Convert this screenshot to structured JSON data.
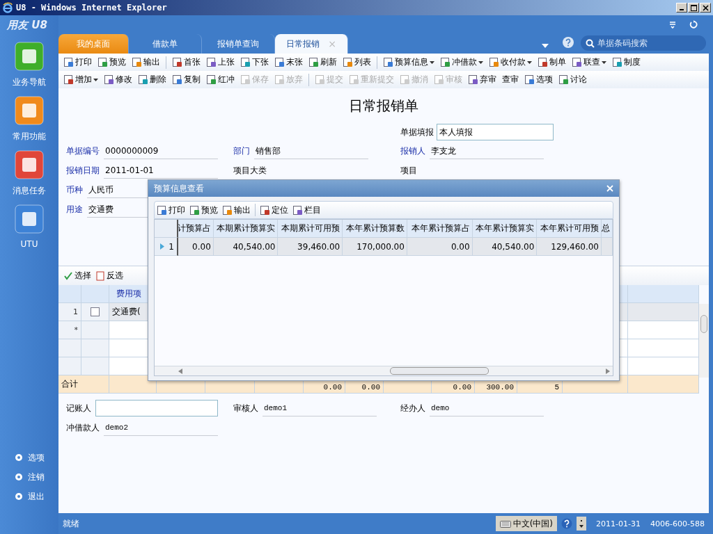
{
  "window": {
    "title": "U8 - Windows Internet Explorer"
  },
  "sidebar": {
    "logo": "用友 U8",
    "items": [
      {
        "label": "业务导航"
      },
      {
        "label": "常用功能"
      },
      {
        "label": "消息任务"
      },
      {
        "label": "UTU"
      }
    ],
    "bottom_items": [
      {
        "label": "选项"
      },
      {
        "label": "注销"
      },
      {
        "label": "退出"
      }
    ]
  },
  "tabs": [
    {
      "label": "我的桌面",
      "kind": "home",
      "selected": false
    },
    {
      "label": "借款单",
      "kind": "doc",
      "selected": false
    },
    {
      "label": "报销单查询",
      "kind": "doc",
      "selected": false
    },
    {
      "label": "日常报销",
      "kind": "doc",
      "selected": true,
      "close": "×"
    }
  ],
  "search": {
    "placeholder": "单据条码搜索"
  },
  "toolbar_rows": [
    [
      [
        {
          "label": "打印"
        },
        {
          "label": "预览"
        },
        {
          "label": "输出"
        }
      ],
      [
        {
          "label": "首张"
        },
        {
          "label": "上张"
        },
        {
          "label": "下张"
        },
        {
          "label": "末张"
        },
        {
          "label": "刷新"
        },
        {
          "label": "列表"
        }
      ],
      [
        {
          "label": "预算信息",
          "dropdown": true
        },
        {
          "label": "冲借款",
          "dropdown": true
        },
        {
          "label": "收付款",
          "dropdown": true
        },
        {
          "label": "制单"
        },
        {
          "label": "联查",
          "dropdown": true
        },
        {
          "label": "制度"
        }
      ]
    ],
    [
      [
        {
          "label": "增加",
          "dropdown": true
        },
        {
          "label": "修改"
        },
        {
          "label": "删除"
        },
        {
          "label": "复制"
        },
        {
          "label": "红冲"
        },
        {
          "label": "保存",
          "disabled": true
        },
        {
          "label": "放弃",
          "disabled": true
        }
      ],
      [
        {
          "label": "提交",
          "disabled": true
        },
        {
          "label": "重新提交",
          "disabled": true
        },
        {
          "label": "撤消",
          "disabled": true
        },
        {
          "label": "审核",
          "disabled": true
        },
        {
          "label": "弃审"
        },
        {
          "label": "查审",
          "no_icon": true
        },
        {
          "label": "选项"
        },
        {
          "label": "讨论"
        }
      ]
    ]
  ],
  "form": {
    "title": "日常报销单",
    "entry": {
      "label": "单据填报",
      "value": "本人填报"
    },
    "rows": [
      [
        {
          "label": "单据编号",
          "value": "0000000009",
          "required": true
        },
        {
          "label": "部门",
          "value": "销售部",
          "required": true
        },
        {
          "label": "报销人",
          "value": "李支龙",
          "required": true
        }
      ],
      [
        {
          "label": "报销日期",
          "value": "2011-01-01",
          "required": true
        },
        {
          "label": "项目大类",
          "required": false
        },
        {
          "label": "项目",
          "required": false
        }
      ],
      [
        {
          "label": "币种",
          "value": "人民币",
          "required": true
        }
      ],
      [
        {
          "label": "用途",
          "value": "交通费",
          "required": true
        }
      ]
    ]
  },
  "grid": {
    "toolbar": [
      {
        "label": "选择"
      },
      {
        "label": "反选"
      }
    ],
    "columns": [
      "费用项"
    ],
    "rows": [
      {
        "num": "1",
        "checked": false,
        "cells": [
          "交通费("
        ]
      },
      {
        "num": "*"
      }
    ],
    "totals": {
      "label": "合计",
      "values": [
        "0.00",
        "0.00",
        "0.00",
        "300.00",
        "5"
      ]
    }
  },
  "footer_fields": [
    [
      {
        "label": "记账人",
        "kind": "input"
      },
      {
        "label": "审核人",
        "value": "demo1",
        "kind": "text"
      },
      {
        "label": "经办人",
        "value": "demo",
        "kind": "text"
      }
    ],
    [
      {
        "label": "冲借款人",
        "value": "demo2",
        "kind": "text"
      }
    ]
  ],
  "dialog": {
    "title": "预算信息查看",
    "toolbar": [
      [
        {
          "label": "打印"
        },
        {
          "label": "预览"
        },
        {
          "label": "输出"
        }
      ],
      [
        {
          "label": "定位"
        },
        {
          "label": "栏目"
        }
      ]
    ],
    "columns": [
      "计预算占",
      "本期累计预算实",
      "本期累计可用预",
      "本年累计预算数",
      "本年累计预算占",
      "本年累计预算实",
      "本年累计可用预",
      "总"
    ],
    "rows": [
      {
        "num": "1",
        "selected": true,
        "cells": [
          "0.00",
          "40,540.00",
          "39,460.00",
          "170,000.00",
          "0.00",
          "40,540.00",
          "129,460.00"
        ]
      }
    ]
  },
  "status_bar": {
    "text": "就绪",
    "ime": "中文(中国)",
    "date": "2011-01-31",
    "phone": "4006-600-588"
  }
}
